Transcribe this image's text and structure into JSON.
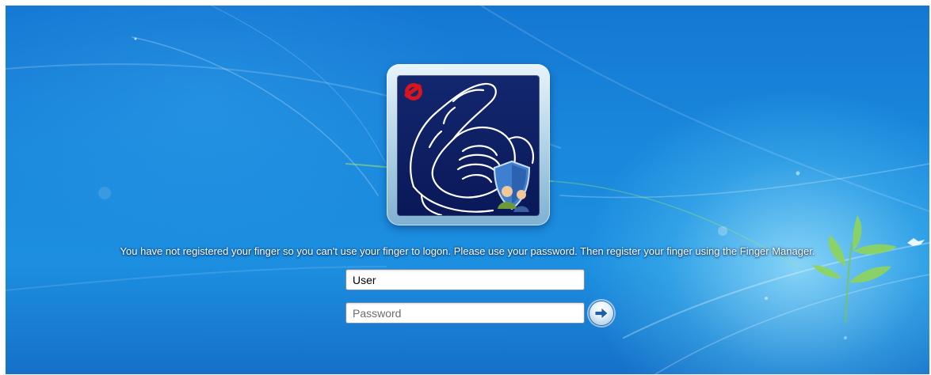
{
  "screen": {
    "accent_color": "#1a88dc"
  },
  "user_tile": {
    "picture_icon": "fingerprint-finger-icon",
    "badge_icon": "shield-users-icon",
    "brand_icon": "vendor-logo-icon"
  },
  "logon": {
    "message": "You have not registered your finger so you can't use your finger to logon. Please use your password. Then register your finger using the Finger Manager.",
    "username_value": "User",
    "password_placeholder": "Password",
    "submit_icon": "arrow-right-icon"
  }
}
